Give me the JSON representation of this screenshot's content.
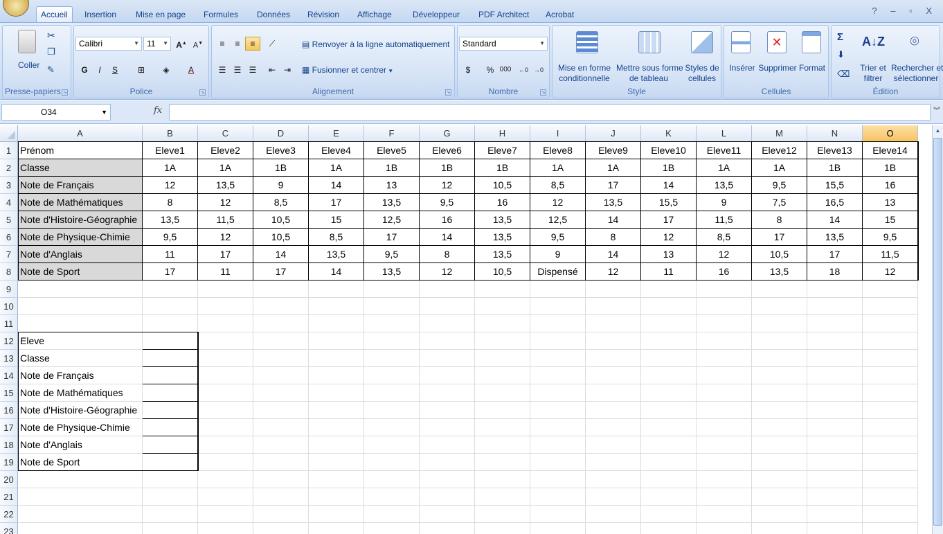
{
  "tabs": [
    "Accueil",
    "Insertion",
    "Mise en page",
    "Formules",
    "Données",
    "Révision",
    "Affichage",
    "Développeur",
    "PDF Architect",
    "Acrobat"
  ],
  "active_tab": "Accueil",
  "window_controls": "? – ▫ X",
  "ribbon": {
    "clipboard": {
      "label": "Presse-papiers",
      "paste": "Coller"
    },
    "font": {
      "label": "Police",
      "name": "Calibri",
      "size": "11",
      "bold": "G",
      "italic": "I",
      "underline": "S"
    },
    "alignment": {
      "label": "Alignement",
      "wrap": "Renvoyer à la ligne automatiquement",
      "merge": "Fusionner et centrer"
    },
    "number": {
      "label": "Nombre",
      "format": "Standard",
      "percent": "%",
      "thousands": "000"
    },
    "style": {
      "label": "Style",
      "cond_format": [
        "Mise en forme",
        "conditionnelle"
      ],
      "table_format": [
        "Mettre sous forme",
        "de tableau"
      ],
      "cell_styles": [
        "Styles de",
        "cellules"
      ]
    },
    "cells": {
      "label": "Cellules",
      "insert": "Insérer",
      "delete": "Supprimer",
      "format": "Format"
    },
    "editing": {
      "label": "Édition",
      "sort": [
        "Trier et",
        "filtrer"
      ],
      "find": [
        "Rechercher et",
        "sélectionner"
      ]
    }
  },
  "formula_bar": {
    "name_box": "O34",
    "fx": "fx",
    "value": ""
  },
  "columns": [
    "A",
    "B",
    "C",
    "D",
    "E",
    "F",
    "G",
    "H",
    "I",
    "J",
    "K",
    "L",
    "M",
    "N",
    "O"
  ],
  "selected_column": "O",
  "row_numbers": [
    1,
    2,
    3,
    4,
    5,
    6,
    7,
    8,
    9,
    10,
    11,
    12,
    13,
    14,
    15,
    16,
    17,
    18,
    19,
    20,
    21,
    22,
    23
  ],
  "table": {
    "rows": [
      [
        "Prénom",
        "Eleve1",
        "Eleve2",
        "Eleve3",
        "Eleve4",
        "Eleve5",
        "Eleve6",
        "Eleve7",
        "Eleve8",
        "Eleve9",
        "Eleve10",
        "Eleve11",
        "Eleve12",
        "Eleve13",
        "Eleve14"
      ],
      [
        "Classe",
        "1A",
        "1A",
        "1B",
        "1A",
        "1B",
        "1B",
        "1B",
        "1A",
        "1A",
        "1B",
        "1A",
        "1A",
        "1B",
        "1B"
      ],
      [
        "Note de Français",
        "12",
        "13,5",
        "9",
        "14",
        "13",
        "12",
        "10,5",
        "8,5",
        "17",
        "14",
        "13,5",
        "9,5",
        "15,5",
        "16"
      ],
      [
        "Note de Mathématiques",
        "8",
        "12",
        "8,5",
        "17",
        "13,5",
        "9,5",
        "16",
        "12",
        "13,5",
        "15,5",
        "9",
        "7,5",
        "16,5",
        "13"
      ],
      [
        "Note d'Histoire-Géographie",
        "13,5",
        "11,5",
        "10,5",
        "15",
        "12,5",
        "16",
        "13,5",
        "12,5",
        "14",
        "17",
        "11,5",
        "8",
        "14",
        "15"
      ],
      [
        "Note de Physique-Chimie",
        "9,5",
        "12",
        "10,5",
        "8,5",
        "17",
        "14",
        "13,5",
        "9,5",
        "8",
        "12",
        "8,5",
        "17",
        "13,5",
        "9,5"
      ],
      [
        "Note d'Anglais",
        "11",
        "17",
        "14",
        "13,5",
        "9,5",
        "8",
        "13,5",
        "9",
        "14",
        "13",
        "12",
        "10,5",
        "17",
        "11,5"
      ],
      [
        "Note de Sport",
        "17",
        "11",
        "17",
        "14",
        "13,5",
        "12",
        "10,5",
        "Dispensé",
        "12",
        "11",
        "16",
        "13,5",
        "18",
        "12"
      ]
    ]
  },
  "lookup_labels": [
    "Eleve",
    "Classe",
    "Note de Français",
    "Note de Mathématiques",
    "Note d'Histoire-Géographie",
    "Note de Physique-Chimie",
    "Note d'Anglais",
    "Note de Sport"
  ],
  "colors": {
    "header_shade": "#d9d9d9",
    "selected_col": "#f8c264",
    "ribbon_text": "#15428b"
  }
}
